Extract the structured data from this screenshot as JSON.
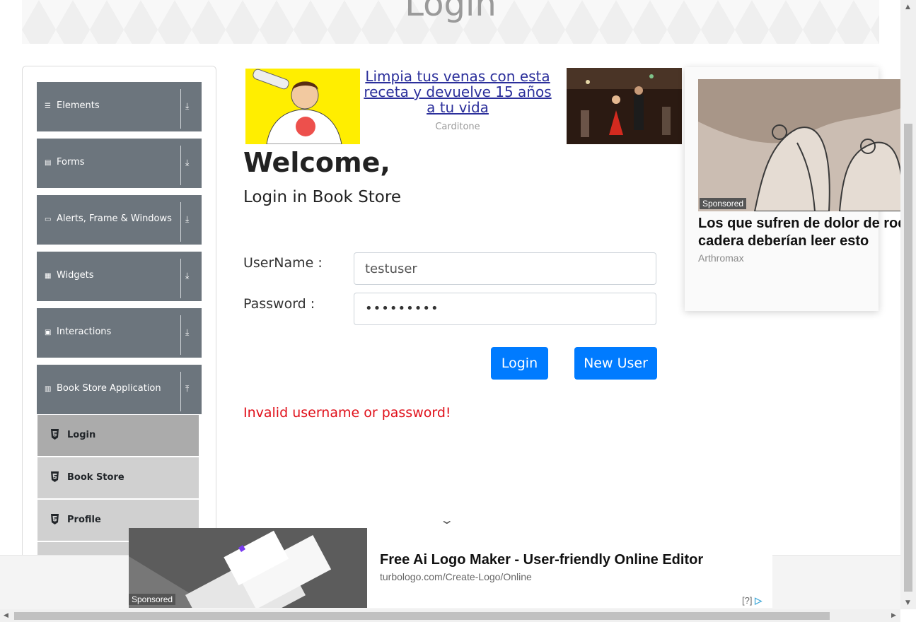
{
  "header": {
    "title": "Login"
  },
  "sidebar": {
    "groups": [
      {
        "label": "Elements",
        "icon": "hamburger-icon"
      },
      {
        "label": "Forms",
        "icon": "document-icon"
      },
      {
        "label": "Alerts, Frame & Windows",
        "icon": "window-icon"
      },
      {
        "label": "Widgets",
        "icon": "grid-icon"
      },
      {
        "label": "Interactions",
        "icon": "calendar-icon"
      },
      {
        "label": "Book Store Application",
        "icon": "books-icon"
      }
    ],
    "book_store_items": [
      {
        "label": "Login",
        "active": true
      },
      {
        "label": "Book Store",
        "active": false
      },
      {
        "label": "Profile",
        "active": false
      }
    ]
  },
  "top_ad": {
    "headline": "Limpia tus venas con esta receta y devuelve 15 años a tu vida",
    "source": "Carditone"
  },
  "main": {
    "welcome": "Welcome,",
    "subtitle": "Login in Book Store",
    "username_label": "UserName :",
    "username_value": "testuser",
    "password_label": "Password :",
    "password_value": "•••••••••",
    "login_button": "Login",
    "new_user_button": "New User",
    "error_message": "Invalid username or password!"
  },
  "side_ad": {
    "tag": "Sponsored",
    "title_line1": "Los que sufren de dolor de rod",
    "title_line2": "cadera deberían leer esto",
    "source": "Arthromax"
  },
  "bottom_ad": {
    "tag": "Sponsored",
    "title": "Free Ai Logo Maker - User-friendly Online Editor",
    "url": "turbologo.com/Create-Logo/Online",
    "adchoice": "[?]"
  },
  "colors": {
    "sidebar_group": "#6c757d",
    "primary_button": "#007bff",
    "error": "#e0101a"
  }
}
